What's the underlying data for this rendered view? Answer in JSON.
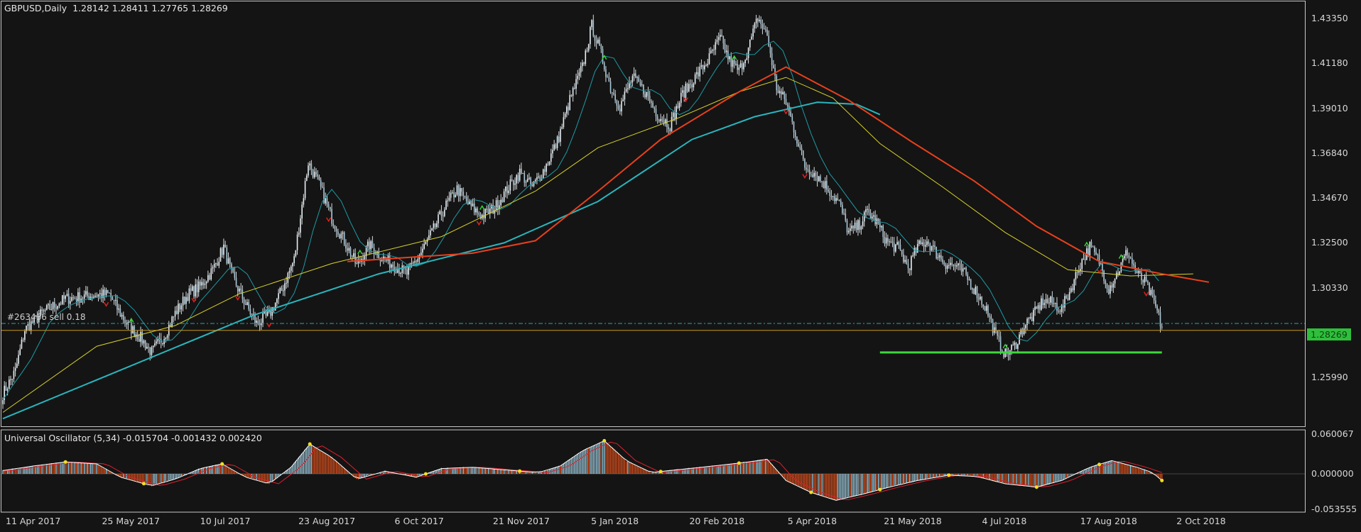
{
  "header": {
    "symbol": "GBPUSD,Daily",
    "ohlc": "1.28142 1.28411 1.27765 1.28269"
  },
  "oscillator": {
    "label": "Universal Oscillator (5,34) -0.015704 -0.001432 0.002420",
    "axis_labels": [
      "0.060067",
      "0.000000",
      "-0.053555"
    ]
  },
  "order_label": "#263466 sell 0.18",
  "price_box": "1.28269",
  "colors": {
    "background": "#141414",
    "grid_border": "#c8c8c8",
    "candle_body": "#a9c8d8",
    "ma_fast_teal": "#1e9aa5",
    "ma_slow_teal": "#2ab5bd",
    "ma_yellow": "#d8d22a",
    "ma_red": "#e8401c",
    "signal_green": "#36d436",
    "signal_red": "#e02020",
    "support_line": "#3ed63e",
    "price_line": "#c8961e",
    "hist_up": "#a6d3e6",
    "hist_down": "#e4541e",
    "osc_line": "#ffffff",
    "osc_signal": "#e02030",
    "osc_dot": "#f0e020"
  },
  "chart_data": [
    {
      "type": "candlestick",
      "title": "GBPUSD,Daily",
      "y_ticks": [
        "1.43350",
        "1.41180",
        "1.39010",
        "1.36840",
        "1.34670",
        "1.32500",
        "1.30330",
        "1.28269",
        "1.25990"
      ],
      "x_ticks": [
        "11 Apr 2017",
        "25 May 2017",
        "10 Jul 2017",
        "23 Aug 2017",
        "6 Oct 2017",
        "21 Nov 2017",
        "5 Jan 2018",
        "20 Feb 2018",
        "5 Apr 2018",
        "21 May 2018",
        "4 Jul 2018",
        "17 Aug 2018",
        "2 Oct 2018"
      ],
      "ylim": [
        1.238,
        1.439
      ],
      "price_trace": [
        [
          0,
          1.252
        ],
        [
          8,
          1.263
        ],
        [
          14,
          1.283
        ],
        [
          25,
          1.291
        ],
        [
          40,
          1.298
        ],
        [
          52,
          1.299
        ],
        [
          60,
          1.3
        ],
        [
          68,
          1.3
        ],
        [
          74,
          1.292
        ],
        [
          80,
          1.285
        ],
        [
          88,
          1.279
        ],
        [
          95,
          1.272
        ],
        [
          103,
          1.28
        ],
        [
          110,
          1.291
        ],
        [
          118,
          1.3
        ],
        [
          126,
          1.304
        ],
        [
          134,
          1.312
        ],
        [
          141,
          1.323
        ],
        [
          146,
          1.31
        ],
        [
          150,
          1.303
        ],
        [
          156,
          1.294
        ],
        [
          162,
          1.286
        ],
        [
          170,
          1.29
        ],
        [
          178,
          1.302
        ],
        [
          186,
          1.317
        ],
        [
          190,
          1.338
        ],
        [
          195,
          1.364
        ],
        [
          202,
          1.353
        ],
        [
          210,
          1.337
        ],
        [
          218,
          1.326
        ],
        [
          226,
          1.314
        ],
        [
          234,
          1.324
        ],
        [
          242,
          1.318
        ],
        [
          250,
          1.314
        ],
        [
          258,
          1.31
        ],
        [
          266,
          1.319
        ],
        [
          274,
          1.33
        ],
        [
          282,
          1.342
        ],
        [
          290,
          1.351
        ],
        [
          298,
          1.343
        ],
        [
          306,
          1.338
        ],
        [
          314,
          1.342
        ],
        [
          322,
          1.351
        ],
        [
          330,
          1.359
        ],
        [
          338,
          1.352
        ],
        [
          346,
          1.361
        ],
        [
          354,
          1.374
        ],
        [
          362,
          1.394
        ],
        [
          370,
          1.41
        ],
        [
          376,
          1.43
        ],
        [
          382,
          1.416
        ],
        [
          388,
          1.4
        ],
        [
          394,
          1.391
        ],
        [
          402,
          1.405
        ],
        [
          410,
          1.398
        ],
        [
          418,
          1.387
        ],
        [
          426,
          1.382
        ],
        [
          434,
          1.397
        ],
        [
          442,
          1.405
        ],
        [
          450,
          1.413
        ],
        [
          458,
          1.424
        ],
        [
          464,
          1.413
        ],
        [
          470,
          1.408
        ],
        [
          476,
          1.419
        ],
        [
          482,
          1.434
        ],
        [
          488,
          1.425
        ],
        [
          494,
          1.4
        ],
        [
          500,
          1.393
        ],
        [
          506,
          1.378
        ],
        [
          512,
          1.362
        ],
        [
          518,
          1.359
        ],
        [
          526,
          1.352
        ],
        [
          534,
          1.344
        ],
        [
          540,
          1.33
        ],
        [
          546,
          1.333
        ],
        [
          552,
          1.34
        ],
        [
          558,
          1.335
        ],
        [
          564,
          1.326
        ],
        [
          572,
          1.322
        ],
        [
          578,
          1.313
        ],
        [
          584,
          1.323
        ],
        [
          590,
          1.326
        ],
        [
          596,
          1.32
        ],
        [
          602,
          1.315
        ],
        [
          608,
          1.314
        ],
        [
          614,
          1.31
        ],
        [
          620,
          1.303
        ],
        [
          628,
          1.293
        ],
        [
          634,
          1.28
        ],
        [
          640,
          1.271
        ],
        [
          646,
          1.275
        ],
        [
          652,
          1.285
        ],
        [
          658,
          1.29
        ],
        [
          664,
          1.297
        ],
        [
          670,
          1.296
        ],
        [
          676,
          1.293
        ],
        [
          682,
          1.303
        ],
        [
          688,
          1.315
        ],
        [
          694,
          1.323
        ],
        [
          700,
          1.316
        ],
        [
          706,
          1.303
        ],
        [
          712,
          1.311
        ],
        [
          718,
          1.321
        ],
        [
          724,
          1.31
        ],
        [
          730,
          1.305
        ],
        [
          736,
          1.294
        ],
        [
          740,
          1.284
        ]
      ],
      "ma_yellow": [
        [
          0,
          1.243
        ],
        [
          60,
          1.275
        ],
        [
          110,
          1.285
        ],
        [
          150,
          1.3
        ],
        [
          210,
          1.315
        ],
        [
          280,
          1.328
        ],
        [
          340,
          1.35
        ],
        [
          380,
          1.371
        ],
        [
          430,
          1.385
        ],
        [
          470,
          1.398
        ],
        [
          500,
          1.405
        ],
        [
          530,
          1.395
        ],
        [
          560,
          1.373
        ],
        [
          600,
          1.352
        ],
        [
          640,
          1.33
        ],
        [
          680,
          1.312
        ],
        [
          720,
          1.309
        ],
        [
          760,
          1.31
        ]
      ],
      "ma_red": [
        [
          220,
          1.316
        ],
        [
          260,
          1.318
        ],
        [
          300,
          1.32
        ],
        [
          340,
          1.326
        ],
        [
          380,
          1.35
        ],
        [
          420,
          1.375
        ],
        [
          470,
          1.398
        ],
        [
          500,
          1.41
        ],
        [
          540,
          1.394
        ],
        [
          580,
          1.374
        ],
        [
          620,
          1.355
        ],
        [
          660,
          1.333
        ],
        [
          700,
          1.316
        ],
        [
          740,
          1.31
        ],
        [
          770,
          1.306
        ]
      ],
      "ma_slow_teal": [
        [
          0,
          1.24
        ],
        [
          80,
          1.265
        ],
        [
          160,
          1.29
        ],
        [
          240,
          1.31
        ],
        [
          320,
          1.325
        ],
        [
          380,
          1.345
        ],
        [
          440,
          1.375
        ],
        [
          480,
          1.386
        ],
        [
          520,
          1.393
        ],
        [
          545,
          1.392
        ],
        [
          560,
          1.387
        ]
      ],
      "support_line": {
        "value": 1.272,
        "x_range": [
          560,
          740
        ]
      },
      "current_price": 1.28269,
      "order_line": 1.286
    },
    {
      "type": "bar",
      "title": "Universal Oscillator (5,34) -0.015704 -0.001432 0.002420",
      "ylim": [
        -0.053555,
        0.060067
      ],
      "values_trace": [
        [
          0,
          0.005
        ],
        [
          20,
          0.012
        ],
        [
          40,
          0.018
        ],
        [
          60,
          0.015
        ],
        [
          75,
          -0.005
        ],
        [
          95,
          -0.018
        ],
        [
          110,
          -0.008
        ],
        [
          126,
          0.008
        ],
        [
          140,
          0.015
        ],
        [
          155,
          -0.005
        ],
        [
          170,
          -0.015
        ],
        [
          184,
          0.01
        ],
        [
          196,
          0.045
        ],
        [
          210,
          0.025
        ],
        [
          226,
          -0.008
        ],
        [
          244,
          0.004
        ],
        [
          264,
          -0.005
        ],
        [
          280,
          0.008
        ],
        [
          300,
          0.01
        ],
        [
          320,
          0.006
        ],
        [
          342,
          0.002
        ],
        [
          356,
          0.012
        ],
        [
          370,
          0.035
        ],
        [
          384,
          0.05
        ],
        [
          398,
          0.02
        ],
        [
          414,
          0.002
        ],
        [
          430,
          0.006
        ],
        [
          446,
          0.01
        ],
        [
          462,
          0.014
        ],
        [
          476,
          0.018
        ],
        [
          488,
          0.022
        ],
        [
          500,
          -0.01
        ],
        [
          516,
          -0.028
        ],
        [
          532,
          -0.04
        ],
        [
          550,
          -0.03
        ],
        [
          566,
          -0.02
        ],
        [
          584,
          -0.01
        ],
        [
          604,
          -0.002
        ],
        [
          622,
          -0.004
        ],
        [
          640,
          -0.015
        ],
        [
          660,
          -0.02
        ],
        [
          676,
          -0.01
        ],
        [
          694,
          0.01
        ],
        [
          708,
          0.02
        ],
        [
          724,
          0.01
        ],
        [
          734,
          0.002
        ],
        [
          740,
          -0.01
        ]
      ]
    }
  ]
}
